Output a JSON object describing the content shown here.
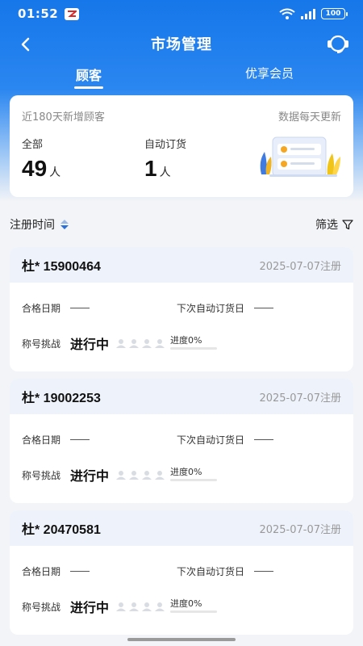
{
  "status_bar": {
    "time": "01:52",
    "battery": "100"
  },
  "nav": {
    "title": "市场管理"
  },
  "tabs": [
    {
      "label": "顾客",
      "active": true
    },
    {
      "label": "优享会员",
      "active": false
    }
  ],
  "summary": {
    "subtitle": "近180天新增顾客",
    "note": "数据每天更新",
    "stats": [
      {
        "label": "全部",
        "value": "49",
        "unit": "人"
      },
      {
        "label": "自动订货",
        "value": "1",
        "unit": "人"
      }
    ]
  },
  "toolbar": {
    "sort_label": "注册时间",
    "filter_label": "筛选"
  },
  "customers": [
    {
      "name": "杜*  15900464",
      "registered": "2025-07-07注册",
      "qualify_label": "合格日期",
      "next_order_label": "下次自动订货日",
      "challenge_label": "称号挑战",
      "challenge_status": "进行中",
      "progress_label": "进度0%",
      "progress": 0
    },
    {
      "name": "杜*  19002253",
      "registered": "2025-07-07注册",
      "qualify_label": "合格日期",
      "next_order_label": "下次自动订货日",
      "challenge_label": "称号挑战",
      "challenge_status": "进行中",
      "progress_label": "进度0%",
      "progress": 0
    },
    {
      "name": "杜*  20470581",
      "registered": "2025-07-07注册",
      "qualify_label": "合格日期",
      "next_order_label": "下次自动订货日",
      "challenge_label": "称号挑战",
      "challenge_status": "进行中",
      "progress_label": "进度0%",
      "progress": 0
    }
  ],
  "colors": {
    "primary": "#1677ea",
    "card_header": "#eef3fb",
    "muted_text": "#999999"
  },
  "icons": {
    "back": "chevron-left-icon",
    "service": "headset-icon",
    "sort": "sort-icon",
    "filter": "filter-icon"
  }
}
